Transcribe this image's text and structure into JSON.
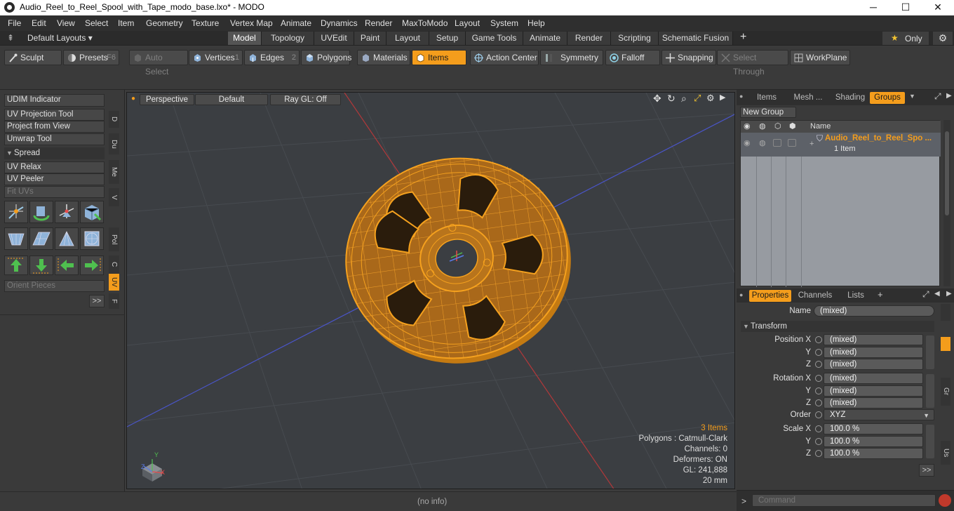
{
  "window": {
    "title": "Audio_Reel_to_Reel_Spool_with_Tape_modo_base.lxo* - MODO",
    "minimize": "─",
    "maximize": "☐",
    "close": "✕"
  },
  "menu": [
    "File",
    "Edit",
    "View",
    "Select",
    "Item",
    "Geometry",
    "Texture",
    "Vertex Map",
    "Animate",
    "Dynamics",
    "Render",
    "MaxToModo",
    "Layout",
    "System",
    "Help"
  ],
  "layout": {
    "default_layouts": "Default Layouts ▾",
    "tabs": [
      "Model",
      "Topology",
      "UVEdit",
      "Paint",
      "Layout",
      "Setup",
      "Game Tools",
      "Animate",
      "Render",
      "Scripting",
      "Schematic Fusion"
    ],
    "active_tab": "Model",
    "add": "+",
    "only": "Only",
    "star": "★"
  },
  "toolbar": {
    "sculpt": "Sculpt",
    "presets": "Presets",
    "presets_key": "F6",
    "auto_select": "Auto Select",
    "vertices": "Vertices",
    "vertices_key": "1",
    "edges": "Edges",
    "edges_key": "2",
    "polygons": "Polygons",
    "materials": "Materials",
    "items": "Items",
    "action_center": "Action Center",
    "symmetry": "Symmetry",
    "falloff": "Falloff",
    "snapping": "Snapping",
    "select_through": "Select Through",
    "workplane": "WorkPlane"
  },
  "left_panel": {
    "udim_indicator": "UDIM Indicator",
    "uv_projection_tool": "UV Projection Tool",
    "project_from_view": "Project from View",
    "unwrap_tool": "Unwrap Tool",
    "spread": "Spread",
    "uv_relax": "UV Relax",
    "uv_peeler": "UV Peeler",
    "fit_uvs": "Fit UVs",
    "orient_pieces": "Orient Pieces",
    "more": ">>",
    "side_tabs": [
      "D",
      "Du",
      "Me",
      "V",
      "Pol",
      "C",
      "UV",
      "F"
    ]
  },
  "viewport": {
    "perspective": "Perspective",
    "default": "Default",
    "ray_gl": "Ray GL: Off",
    "stats": {
      "items": "3 Items",
      "polygons": "Polygons : Catmull-Clark",
      "channels": "Channels: 0",
      "deformers": "Deformers: ON",
      "gl": "GL: 241,888",
      "scale": "20 mm"
    },
    "axis_y": "Y",
    "axis_x": "X",
    "axis_z": "Z"
  },
  "items_panel": {
    "tabs": [
      "Items",
      "Mesh ...",
      "Shading",
      "Groups"
    ],
    "active_tab": "Groups",
    "new_group": "New Group",
    "name_header": "Name",
    "group_name": "Audio_Reel_to_Reel_Spo ...",
    "group_count": "1 Item"
  },
  "properties_panel": {
    "tabs": [
      "Properties",
      "Channels",
      "Lists"
    ],
    "active_tab": "Properties",
    "add": "+",
    "name_label": "Name",
    "name_value": "(mixed)",
    "transform": "Transform",
    "position_x_label": "Position X",
    "position_x": "(mixed)",
    "position_y_label": "Y",
    "position_y": "(mixed)",
    "position_z_label": "Z",
    "position_z": "(mixed)",
    "rotation_x_label": "Rotation X",
    "rotation_x": "(mixed)",
    "rotation_y_label": "Y",
    "rotation_y": "(mixed)",
    "rotation_z_label": "Z",
    "rotation_z": "(mixed)",
    "order_label": "Order",
    "order_value": "XYZ",
    "scale_x_label": "Scale X",
    "scale_x": "100.0 %",
    "scale_y_label": "Y",
    "scale_y": "100.0 %",
    "scale_z_label": "Z",
    "scale_z": "100.0 %",
    "more": ">>",
    "side_tabs": [
      "Gr",
      "Us"
    ]
  },
  "command": {
    "placeholder": "Command",
    "prompt": ">"
  },
  "status": {
    "info": "(no info)"
  },
  "colors": {
    "accent": "#f49d1c",
    "mesh_wire": "#f5a11e",
    "viewport_bg": "#3b3e42"
  }
}
